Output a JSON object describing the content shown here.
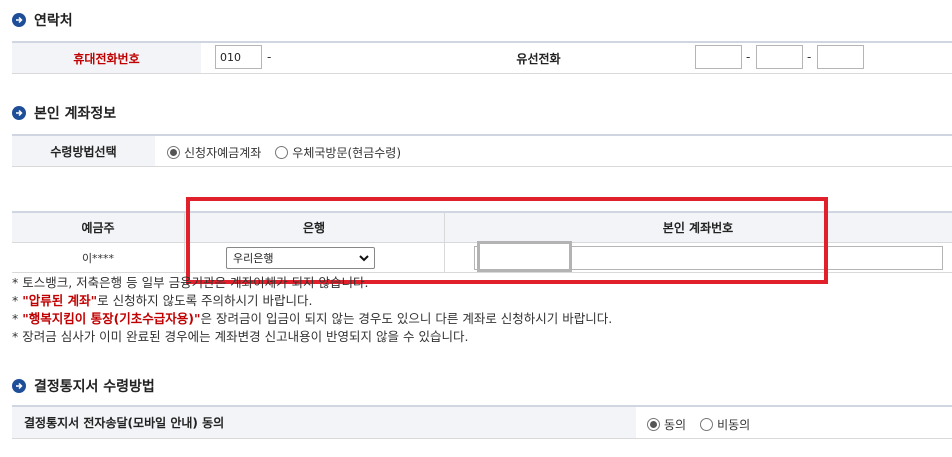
{
  "sections": {
    "contact": "연락처",
    "account": "본인 계좌정보",
    "notice": "결정통지서 수령방법"
  },
  "contact": {
    "mobile_label": "휴대전화번호",
    "mobile_prefix": "010",
    "dash": "-",
    "landline_label": "유선전화"
  },
  "receipt": {
    "label": "수령방법선택",
    "options": [
      "신청자예금계좌",
      "우체국방문(현금수령)"
    ],
    "selected": 0
  },
  "account_table": {
    "headers": [
      "예금주",
      "은행",
      "본인 계좌번호"
    ],
    "holder": "이****",
    "bank_selected": "우리은행"
  },
  "notes": {
    "line1": "* 토스뱅크, 저축은행 등 일부 금융기관은 계좌이체가 되지 않습니다.",
    "line2_red": "\"압류된 계좌\"",
    "line2_rest": "로 신청하지 않도록 주의하시기 바랍니다.",
    "line3_red": "\"행복지킴이 통장(기초수급자용)\"",
    "line3_rest": "은 장려금이 입금이 되지 않는 경우도 있으니 다른 계좌로 신청하시기 바랍니다.",
    "line4": "* 장려금 심사가 이미 완료된 경우에는 계좌변경 신고내용이 반영되지 않을 수 있습니다."
  },
  "consent": {
    "label": "결정통지서 전자송달(모바일 안내) 동의",
    "options": [
      "동의",
      "비동의"
    ],
    "selected": 0
  },
  "colors": {
    "accent": "#1f4e99",
    "highlight": "#e0202a",
    "warning_text": "#c00000"
  }
}
